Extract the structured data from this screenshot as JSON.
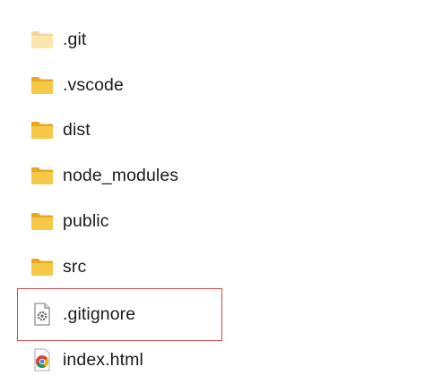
{
  "explorer": {
    "items": [
      {
        "name": ".git",
        "icon": "folder-icon",
        "kind": "folder",
        "faded": true
      },
      {
        "name": ".vscode",
        "icon": "folder-icon",
        "kind": "folder",
        "faded": false
      },
      {
        "name": "dist",
        "icon": "folder-icon",
        "kind": "folder",
        "faded": false
      },
      {
        "name": "node_modules",
        "icon": "folder-icon",
        "kind": "folder",
        "faded": false
      },
      {
        "name": "public",
        "icon": "folder-icon",
        "kind": "folder",
        "faded": false
      },
      {
        "name": "src",
        "icon": "folder-icon",
        "kind": "folder",
        "faded": false
      },
      {
        "name": ".gitignore",
        "icon": "gear-file-icon",
        "kind": "file",
        "faded": false
      },
      {
        "name": "index.html",
        "icon": "chrome-icon",
        "kind": "file",
        "faded": false
      }
    ],
    "highlighted_item": ".gitignore"
  },
  "colors": {
    "folder_body": "#F7C948",
    "folder_back": "#E9A820",
    "highlight_border": "#D9474B",
    "text": "#1B1B1B"
  }
}
